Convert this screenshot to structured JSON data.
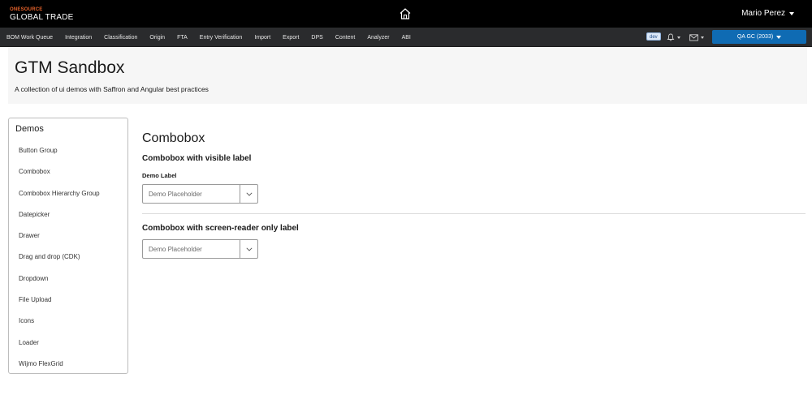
{
  "header": {
    "brand_top": "ONESOURCE",
    "brand_bottom": "GLOBAL TRADE",
    "home_icon": "home-icon",
    "user_name": "Mario Perez"
  },
  "nav": {
    "items": [
      "BOM Work Queue",
      "Integration",
      "Classification",
      "Origin",
      "FTA",
      "Entry Verification",
      "Import",
      "Export",
      "DPS",
      "Content",
      "Analyzer",
      "ABI"
    ],
    "env_badge": "dev",
    "bell_icon": "bell-icon",
    "mail_icon": "mail-icon",
    "region_label": "QA GC (2033)"
  },
  "hero": {
    "title": "GTM Sandbox",
    "subtitle": "A collection of ui demos with Saffron and Angular best practices"
  },
  "sidebar": {
    "title": "Demos",
    "items": [
      "Button Group",
      "Combobox",
      "Combobox Hierarchy Group",
      "Datepicker",
      "Drawer",
      "Drag and drop (CDK)",
      "Dropdown",
      "File Upload",
      "Icons",
      "Loader",
      "Wijmo FlexGrid"
    ]
  },
  "main": {
    "title": "Combobox",
    "section1": {
      "title": "Combobox with visible label",
      "label": "Demo Label",
      "placeholder": "Demo Placeholder"
    },
    "section2": {
      "title": "Combobox with screen-reader only label",
      "placeholder": "Demo Placeholder"
    }
  },
  "colors": {
    "topbar": "#000000",
    "navbar": "#2a2b2d",
    "accent_blue": "#0f6bb3",
    "brand_orange": "#e8632b",
    "hero_bg": "#f6f6f6"
  }
}
